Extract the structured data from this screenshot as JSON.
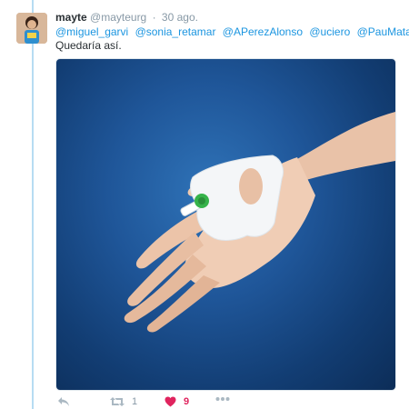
{
  "tweet": {
    "author_name": "mayte",
    "author_handle": "@mayteurg",
    "separator": "·",
    "date": "30 ago.",
    "mentions": [
      "@miguel_garvi",
      "@sonia_retamar",
      "@APerezAlonso",
      "@uciero",
      "@PauMatalap"
    ],
    "text": "Quedaría así.",
    "retweet_count": "1",
    "like_count": "9",
    "liked": true
  },
  "colors": {
    "link": "#1b95e0",
    "like": "#e0245e",
    "muted": "#8899a6",
    "thread_line": "#b7dcf2"
  },
  "icons": {
    "reply": "reply-icon",
    "retweet": "retweet-icon",
    "like": "heart-icon",
    "more": "more-dots-icon"
  }
}
